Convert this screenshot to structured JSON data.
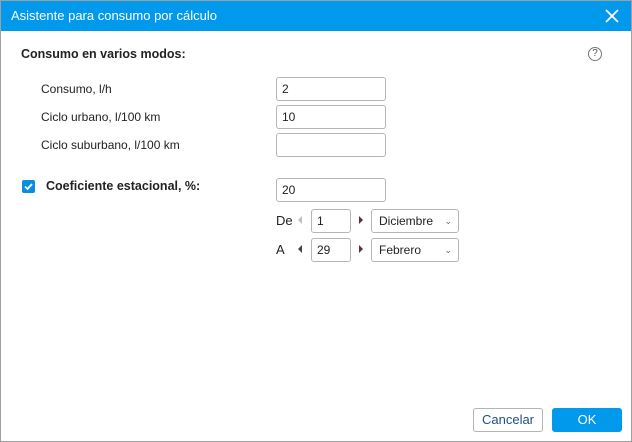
{
  "title": "Asistente para consumo por cálculo",
  "section_heading": "Consumo en varios modos:",
  "fields": [
    {
      "label": "Consumo, l/h",
      "value": "2"
    },
    {
      "label": "Ciclo urbano, l/100 km",
      "value": "10"
    },
    {
      "label": "Ciclo suburbano, l/100 km",
      "value": ""
    }
  ],
  "seasonal": {
    "label": "Coeficiente estacional, %:",
    "checked": true,
    "value": "20",
    "from": {
      "label": "De",
      "day": "1",
      "month": "Diciembre"
    },
    "to": {
      "label": "A",
      "day": "29",
      "month": "Febrero"
    }
  },
  "buttons": {
    "cancel": "Cancelar",
    "ok": "OK"
  },
  "help_glyph": "?",
  "colors": {
    "accent": "#0099ec"
  }
}
